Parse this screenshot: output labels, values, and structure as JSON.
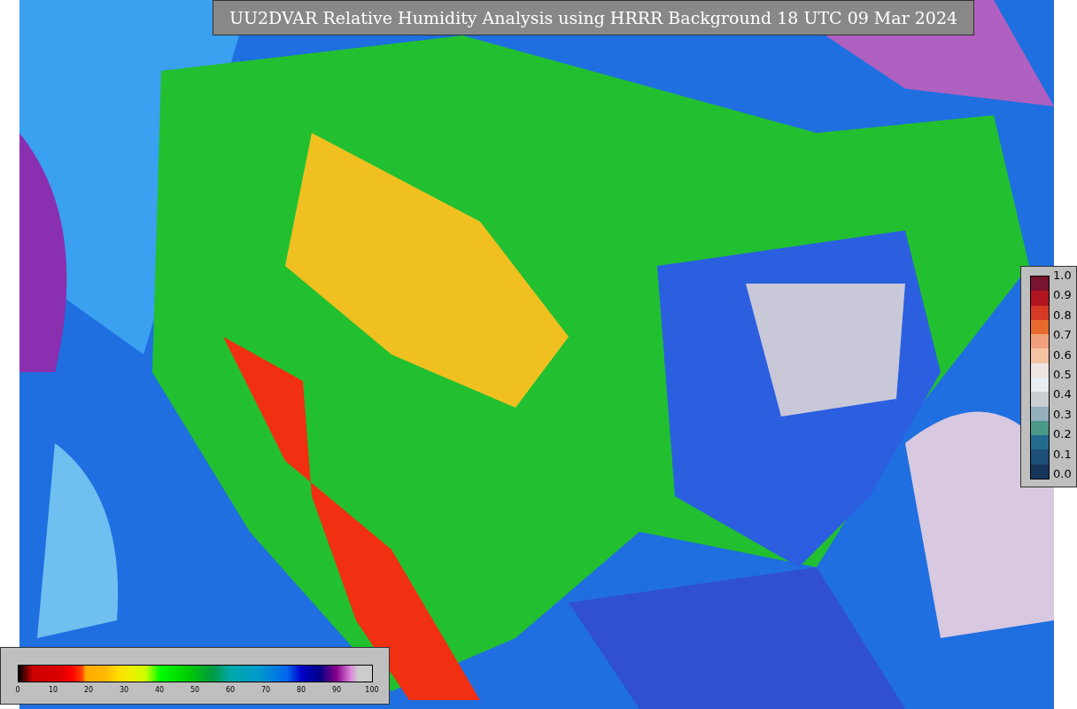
{
  "title": "UU2DVAR Relative Humidity Analysis using HRRR Background 18 UTC 09 Mar 2024",
  "ratio_colorbar": {
    "ticks": [
      "1.0",
      "0.9",
      "0.8",
      "0.7",
      "0.6",
      "0.5",
      "0.4",
      "0.3",
      "0.2",
      "0.1",
      "0.0"
    ]
  },
  "humidity_colorbar": {
    "ticks": [
      "0",
      "10",
      "20",
      "30",
      "40",
      "50",
      "60",
      "70",
      "80",
      "90",
      "100"
    ]
  }
}
